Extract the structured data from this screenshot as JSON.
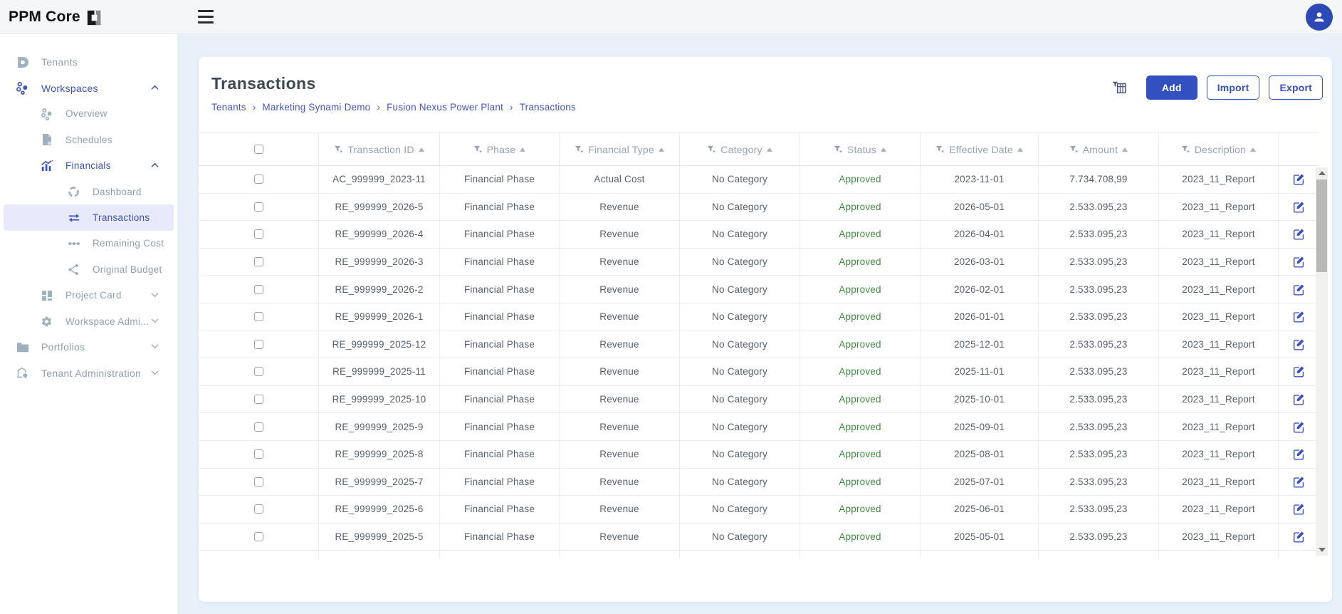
{
  "topbar": {
    "brand": "PPM Core"
  },
  "colors": {
    "primary": "#3350c0",
    "link": "#4455cc",
    "status_approved": "#3e8e41",
    "selected_bg": "#e8eafb"
  },
  "icons": {
    "menu": "hamburger",
    "user": "person-circle",
    "brand": "d-mark",
    "filter": "funnel-caret",
    "sort": "triangle-up",
    "edit": "pencil-square",
    "column_chooser": "table-funnel",
    "expanded": "chevron-up",
    "collapsed": "chevron-down"
  },
  "sidebar": {
    "items": [
      {
        "label": "Tenants"
      },
      {
        "label": "Workspaces"
      },
      {
        "label": "Overview"
      },
      {
        "label": "Schedules"
      },
      {
        "label": "Financials"
      },
      {
        "label": "Dashboard"
      },
      {
        "label": "Transactions"
      },
      {
        "label": "Remaining Cost"
      },
      {
        "label": "Original Budget"
      },
      {
        "label": "Project Card"
      },
      {
        "label": "Workspace Admi..."
      },
      {
        "label": "Portfolios"
      },
      {
        "label": "Tenant Administration"
      }
    ]
  },
  "page": {
    "title": "Transactions",
    "breadcrumb": {
      "items": [
        "Tenants",
        "Marketing Synami Demo",
        "Fusion Nexus Power Plant",
        "Transactions"
      ],
      "separator": "›"
    },
    "actions": {
      "add": "Add",
      "import": "Import",
      "export": "Export"
    }
  },
  "table": {
    "columns": [
      "Transaction ID",
      "Phase",
      "Financial Type",
      "Category",
      "Status",
      "Effective Date",
      "Amount",
      "Description"
    ],
    "rows": [
      {
        "id": "AC_999999_2023-11",
        "phase": "Financial Phase",
        "financial_type": "Actual Cost",
        "category": "No Category",
        "status": "Approved",
        "effective_date": "2023-11-01",
        "amount": "7.734.708,99",
        "description": "2023_11_Report"
      },
      {
        "id": "RE_999999_2026-5",
        "phase": "Financial Phase",
        "financial_type": "Revenue",
        "category": "No Category",
        "status": "Approved",
        "effective_date": "2026-05-01",
        "amount": "2.533.095,23",
        "description": "2023_11_Report"
      },
      {
        "id": "RE_999999_2026-4",
        "phase": "Financial Phase",
        "financial_type": "Revenue",
        "category": "No Category",
        "status": "Approved",
        "effective_date": "2026-04-01",
        "amount": "2.533.095,23",
        "description": "2023_11_Report"
      },
      {
        "id": "RE_999999_2026-3",
        "phase": "Financial Phase",
        "financial_type": "Revenue",
        "category": "No Category",
        "status": "Approved",
        "effective_date": "2026-03-01",
        "amount": "2.533.095,23",
        "description": "2023_11_Report"
      },
      {
        "id": "RE_999999_2026-2",
        "phase": "Financial Phase",
        "financial_type": "Revenue",
        "category": "No Category",
        "status": "Approved",
        "effective_date": "2026-02-01",
        "amount": "2.533.095,23",
        "description": "2023_11_Report"
      },
      {
        "id": "RE_999999_2026-1",
        "phase": "Financial Phase",
        "financial_type": "Revenue",
        "category": "No Category",
        "status": "Approved",
        "effective_date": "2026-01-01",
        "amount": "2.533.095,23",
        "description": "2023_11_Report"
      },
      {
        "id": "RE_999999_2025-12",
        "phase": "Financial Phase",
        "financial_type": "Revenue",
        "category": "No Category",
        "status": "Approved",
        "effective_date": "2025-12-01",
        "amount": "2.533.095,23",
        "description": "2023_11_Report"
      },
      {
        "id": "RE_999999_2025-11",
        "phase": "Financial Phase",
        "financial_type": "Revenue",
        "category": "No Category",
        "status": "Approved",
        "effective_date": "2025-11-01",
        "amount": "2.533.095,23",
        "description": "2023_11_Report"
      },
      {
        "id": "RE_999999_2025-10",
        "phase": "Financial Phase",
        "financial_type": "Revenue",
        "category": "No Category",
        "status": "Approved",
        "effective_date": "2025-10-01",
        "amount": "2.533.095,23",
        "description": "2023_11_Report"
      },
      {
        "id": "RE_999999_2025-9",
        "phase": "Financial Phase",
        "financial_type": "Revenue",
        "category": "No Category",
        "status": "Approved",
        "effective_date": "2025-09-01",
        "amount": "2.533.095,23",
        "description": "2023_11_Report"
      },
      {
        "id": "RE_999999_2025-8",
        "phase": "Financial Phase",
        "financial_type": "Revenue",
        "category": "No Category",
        "status": "Approved",
        "effective_date": "2025-08-01",
        "amount": "2.533.095,23",
        "description": "2023_11_Report"
      },
      {
        "id": "RE_999999_2025-7",
        "phase": "Financial Phase",
        "financial_type": "Revenue",
        "category": "No Category",
        "status": "Approved",
        "effective_date": "2025-07-01",
        "amount": "2.533.095,23",
        "description": "2023_11_Report"
      },
      {
        "id": "RE_999999_2025-6",
        "phase": "Financial Phase",
        "financial_type": "Revenue",
        "category": "No Category",
        "status": "Approved",
        "effective_date": "2025-06-01",
        "amount": "2.533.095,23",
        "description": "2023_11_Report"
      },
      {
        "id": "RE_999999_2025-5",
        "phase": "Financial Phase",
        "financial_type": "Revenue",
        "category": "No Category",
        "status": "Approved",
        "effective_date": "2025-05-01",
        "amount": "2.533.095,23",
        "description": "2023_11_Report"
      }
    ]
  }
}
